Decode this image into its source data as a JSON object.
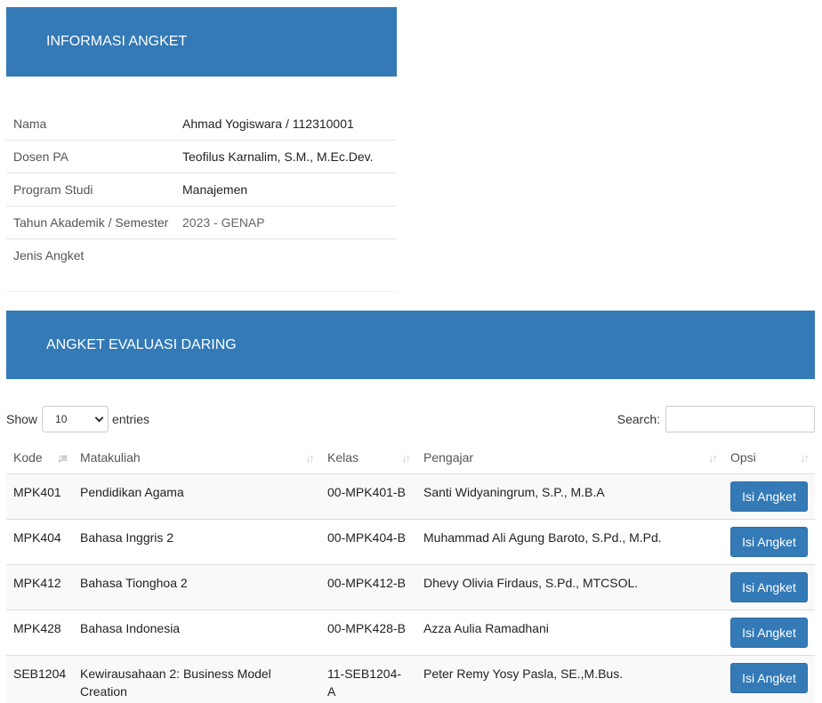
{
  "info_panel": {
    "title": "INFORMASI ANGKET"
  },
  "info_rows": [
    {
      "label": "Nama",
      "value": "Ahmad Yogiswara / 112310001"
    },
    {
      "label": "Dosen PA",
      "value": "Teofilus Karnalim, S.M., M.Ec.Dev."
    },
    {
      "label": "Program Studi",
      "value": "Manajemen"
    },
    {
      "label": "Tahun Akademik / Semester",
      "value": "2023 - GENAP"
    },
    {
      "label": "Jenis Angket",
      "value": ""
    }
  ],
  "eval_panel": {
    "title": "ANGKET EVALUASI DARING"
  },
  "controls": {
    "show_label": "Show",
    "entries_value": "10",
    "entries_label": "entries",
    "search_label": "Search:",
    "search_value": ""
  },
  "table": {
    "headers": [
      "Kode",
      "Matakuliah",
      "Kelas",
      "Pengajar",
      "Opsi"
    ],
    "rows": [
      {
        "kode": "MPK401",
        "matakuliah": "Pendidikan Agama",
        "kelas": "00-MPK401-B",
        "pengajar": "Santi Widyaningrum, S.P., M.B.A",
        "action": "Isi Angket"
      },
      {
        "kode": "MPK404",
        "matakuliah": "Bahasa Inggris 2",
        "kelas": "00-MPK404-B",
        "pengajar": "Muhammad Ali Agung Baroto, S.Pd., M.Pd.",
        "action": "Isi Angket"
      },
      {
        "kode": "MPK412",
        "matakuliah": "Bahasa Tionghoa 2",
        "kelas": "00-MPK412-B",
        "pengajar": "Dhevy Olivia Firdaus, S.Pd., MTCSOL.",
        "action": "Isi Angket"
      },
      {
        "kode": "MPK428",
        "matakuliah": "Bahasa Indonesia",
        "kelas": "00-MPK428-B",
        "pengajar": "Azza Aulia Ramadhani",
        "action": "Isi Angket"
      },
      {
        "kode": "SEB1204",
        "matakuliah": "Kewirausahaan 2: Business Model Creation",
        "kelas": "11-SEB1204-A",
        "pengajar": "Peter Remy Yosy Pasla, SE.,M.Bus.",
        "action": "Isi Angket"
      }
    ]
  },
  "colors": {
    "panel_header": "#337ab7",
    "button": "#337ab7"
  },
  "icons": {
    "sort_active": "sort-amount-down-icon",
    "sort_inactive": "sort-arrows-icon",
    "select": "chevron-down-icon"
  }
}
